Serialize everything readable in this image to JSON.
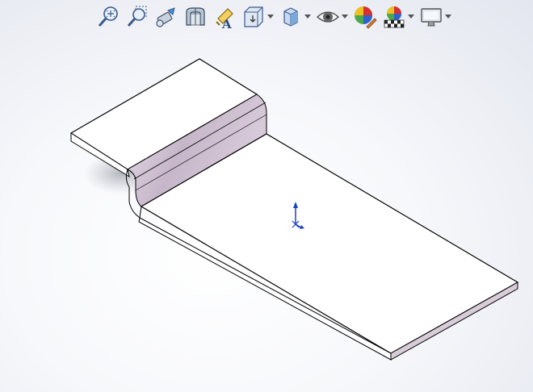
{
  "toolbar": {
    "tools": [
      {
        "name": "zoom-to-fit-icon",
        "has_dropdown": false
      },
      {
        "name": "zoom-to-area-icon",
        "has_dropdown": false
      },
      {
        "name": "previous-view-icon",
        "has_dropdown": false
      },
      {
        "name": "section-view-icon",
        "has_dropdown": false
      },
      {
        "name": "dynamic-annotation-views-icon",
        "has_dropdown": false
      },
      {
        "name": "view-orientation-icon",
        "has_dropdown": true
      },
      {
        "name": "display-style-icon",
        "has_dropdown": true
      },
      {
        "name": "hide-show-items-icon",
        "has_dropdown": true
      },
      {
        "name": "edit-appearance-icon",
        "has_dropdown": false
      },
      {
        "name": "apply-scene-icon",
        "has_dropdown": true
      },
      {
        "name": "view-settings-icon",
        "has_dropdown": true
      }
    ]
  },
  "colors": {
    "part_face": "#ffffff",
    "bend_face": "#c9b9cc",
    "edge_face": "#d8ccd8",
    "edge_line": "#000000",
    "triad_axis": "#1a3fc4"
  }
}
